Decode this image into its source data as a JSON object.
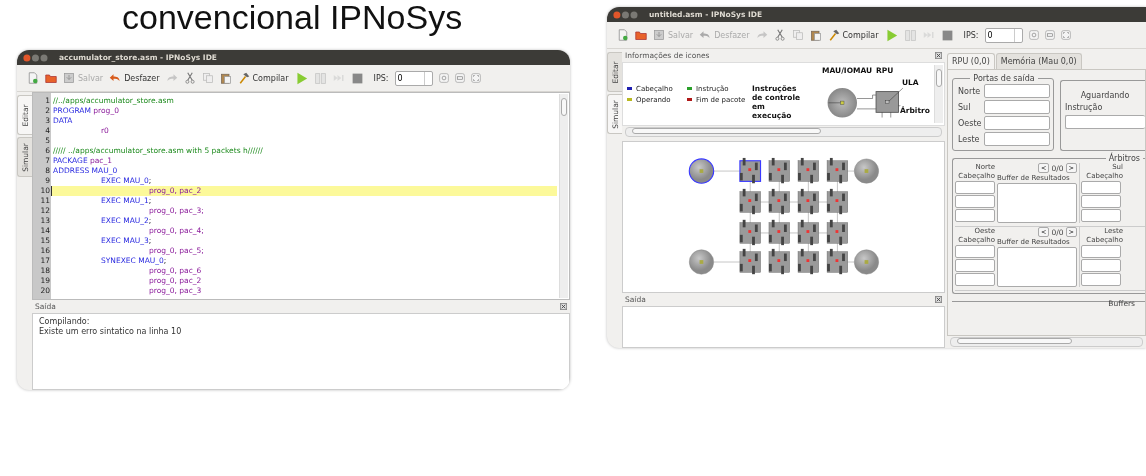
{
  "slide_title": "convencional IPNoSys",
  "editor_window": {
    "title": "accumulator_store.asm - IPNoSys IDE",
    "toolbar": {
      "save": {
        "label": "Salvar",
        "disabled": true
      },
      "undo": {
        "label": "Desfazer",
        "disabled": false
      },
      "compile": {
        "label": "Compilar"
      },
      "ips": {
        "label": "IPS:",
        "value": "0"
      }
    },
    "side_tabs": [
      {
        "label": "Editar",
        "selected": true
      },
      {
        "label": "Simular",
        "selected": false
      }
    ],
    "code_lines": [
      {
        "number": "1",
        "current": false,
        "segments": [
          {
            "text": "//../apps/accumulator_store.asm",
            "kind": "comment"
          }
        ]
      },
      {
        "number": "2",
        "current": false,
        "segments": [
          {
            "text": "PROGRAM",
            "kind": "keyword"
          },
          {
            "text": " prog_0",
            "kind": "ident"
          }
        ]
      },
      {
        "number": "3",
        "current": false,
        "segments": [
          {
            "text": "DATA",
            "kind": "keyword"
          }
        ]
      },
      {
        "number": "4",
        "current": false,
        "segments": [
          {
            "text": "\tr0",
            "kind": "ident"
          }
        ]
      },
      {
        "number": "5",
        "current": false
      },
      {
        "number": "6",
        "current": false,
        "segments": [
          {
            "text": "///// ../apps/accumulator_store.asm with 5 packets h//////",
            "kind": "comment"
          }
        ]
      },
      {
        "number": "7",
        "current": false,
        "segments": [
          {
            "text": "PACKAGE",
            "kind": "keyword"
          },
          {
            "text": " pac_1",
            "kind": "ident"
          }
        ]
      },
      {
        "number": "8",
        "current": false,
        "segments": [
          {
            "text": "ADDRESS MAU_0",
            "kind": "keyword"
          }
        ]
      },
      {
        "number": "9",
        "current": false,
        "segments": [
          {
            "text": "\tEXEC MAU_0",
            "kind": "keyword"
          },
          {
            "text": ";",
            "kind": "plain"
          }
        ]
      },
      {
        "number": "10",
        "current": true,
        "segments": [
          {
            "text": "\t\tprog_0, pac_2",
            "kind": "ident"
          }
        ]
      },
      {
        "number": "11",
        "current": false,
        "segments": [
          {
            "text": "\tEXEC MAU_1",
            "kind": "keyword"
          },
          {
            "text": ";",
            "kind": "plain"
          }
        ]
      },
      {
        "number": "12",
        "current": false,
        "segments": [
          {
            "text": "\t\tprog_0, pac_3;",
            "kind": "ident"
          }
        ]
      },
      {
        "number": "13",
        "current": false,
        "segments": [
          {
            "text": "\tEXEC MAU_2",
            "kind": "keyword"
          },
          {
            "text": ";",
            "kind": "plain"
          }
        ]
      },
      {
        "number": "14",
        "current": false,
        "segments": [
          {
            "text": "\t\tprog_0, pac_4;",
            "kind": "ident"
          }
        ]
      },
      {
        "number": "15",
        "current": false,
        "segments": [
          {
            "text": "\tEXEC MAU_3",
            "kind": "keyword"
          },
          {
            "text": ";",
            "kind": "plain"
          }
        ]
      },
      {
        "number": "16",
        "current": false,
        "segments": [
          {
            "text": "\t\tprog_0, pac_5;",
            "kind": "ident"
          }
        ]
      },
      {
        "number": "17",
        "current": false,
        "segments": [
          {
            "text": "\tSYNEXEC MAU_0",
            "kind": "keyword"
          },
          {
            "text": ";",
            "kind": "plain"
          }
        ]
      },
      {
        "number": "18",
        "current": false,
        "segments": [
          {
            "text": "\t\tprog_0, pac_6",
            "kind": "ident"
          }
        ]
      },
      {
        "number": "19",
        "current": false,
        "segments": [
          {
            "text": "\t\tprog_0, pac_2",
            "kind": "ident"
          }
        ]
      },
      {
        "number": "20",
        "current": false,
        "segments": [
          {
            "text": "\t\tprog_0, pac_3",
            "kind": "ident"
          }
        ]
      }
    ],
    "output": {
      "title": "Saída",
      "lines": [
        "Compilando:",
        "Existe um erro sintatico na linha 10"
      ]
    }
  },
  "simulator_window": {
    "title": "untitled.asm - IPNoSys IDE",
    "toolbar": {
      "save": {
        "label": "Salvar",
        "disabled": true
      },
      "undo": {
        "label": "Desfazer",
        "disabled": true
      },
      "compile": {
        "label": "Compilar"
      },
      "ips": {
        "label": "IPS:",
        "value": "0"
      }
    },
    "side_tabs": [
      {
        "label": "Editar",
        "selected": false
      },
      {
        "label": "Simular",
        "selected": true
      }
    ],
    "icon_info": {
      "title": "Informações de icones",
      "legend": [
        {
          "label": "Cabeçalho",
          "color": "#1f1fb0"
        },
        {
          "label": "Instrução",
          "color": "#2aa02a"
        },
        {
          "label": "Operando",
          "color": "#b8b820"
        },
        {
          "label": "Fim de pacote",
          "color": "#b01818"
        }
      ],
      "diagram_labels": {
        "mau": "MAU/IOMAU",
        "rpu": "RPU",
        "ula": "ULA",
        "control": "Instruções de controle em execução",
        "arbiter": "Árbitro"
      }
    },
    "mesh": {
      "maus": [
        {
          "selected": true
        },
        {
          "selected": false
        },
        {
          "selected": false
        },
        {
          "selected": false
        }
      ],
      "rpus": [
        [
          {
            "selected": true
          },
          {
            "selected": false
          },
          {
            "selected": false
          },
          {
            "selected": false
          }
        ],
        [
          {
            "selected": false
          },
          {
            "selected": false
          },
          {
            "selected": false
          },
          {
            "selected": false
          }
        ],
        [
          {
            "selected": false
          },
          {
            "selected": false
          },
          {
            "selected": false
          },
          {
            "selected": false
          }
        ],
        [
          {
            "selected": false
          },
          {
            "selected": false
          },
          {
            "selected": false
          },
          {
            "selected": false
          }
        ]
      ]
    },
    "output": {
      "title": "Saída"
    },
    "rpu_tabs": [
      {
        "label": "RPU (0,0)",
        "selected": true
      },
      {
        "label": "Memória (Mau 0,0)",
        "selected": false
      }
    ],
    "output_ports": {
      "title": "Portas de saída",
      "ports": [
        "Norte",
        "Sul",
        "Oeste",
        "Leste"
      ]
    },
    "waiting": {
      "title": "Aguardando",
      "label": "Instrução"
    },
    "arbiters": {
      "title": "Árbitros",
      "sections": [
        {
          "name": "Norte",
          "prev": "<",
          "counter": "0/0",
          "next": ">",
          "header_label": "Cabeçalho",
          "buffer_label": "Buffer de Resultados",
          "side_name": "Sul",
          "side_header_label": "Cabeçalho"
        },
        {
          "name": "Oeste",
          "prev": "<",
          "counter": "0/0",
          "next": ">",
          "header_label": "Cabeçalho",
          "buffer_label": "Buffer de Resultados",
          "side_name": "Leste",
          "side_header_label": "Cabeçalho"
        }
      ]
    },
    "buffers_title": "Buffers"
  }
}
